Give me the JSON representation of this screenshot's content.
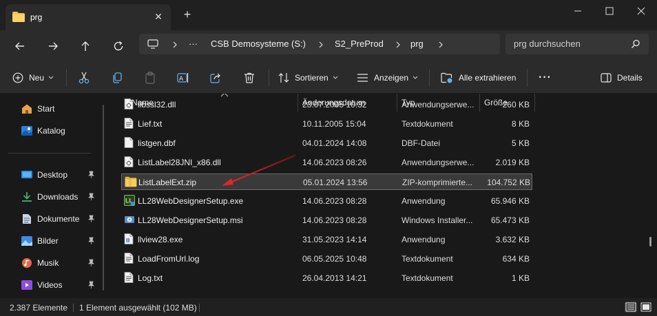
{
  "window": {
    "tab_title": "prg",
    "tab_close": "✕",
    "new_tab": "+"
  },
  "address": {
    "ellipsis": "···",
    "crumbs": [
      "CSB Demosysteme (S:)",
      "S2_PreProd",
      "prg"
    ],
    "search_placeholder": "prg durchsuchen"
  },
  "toolbar": {
    "new_label": "Neu",
    "sort_label": "Sortieren",
    "view_label": "Anzeigen",
    "extract_label": "Alle extrahieren",
    "more_label": "···",
    "details_label": "Details"
  },
  "sidebar": {
    "items": [
      {
        "label": "Start",
        "icon": "home-icon",
        "pinned": false
      },
      {
        "label": "Katalog",
        "icon": "gallery-icon",
        "pinned": false
      },
      {
        "label": "Desktop",
        "icon": "desktop-icon",
        "pinned": true
      },
      {
        "label": "Downloads",
        "icon": "downloads-icon",
        "pinned": true
      },
      {
        "label": "Dokumente",
        "icon": "documents-icon",
        "pinned": true
      },
      {
        "label": "Bilder",
        "icon": "pictures-icon",
        "pinned": true
      },
      {
        "label": "Musik",
        "icon": "music-icon",
        "pinned": true
      },
      {
        "label": "Videos",
        "icon": "videos-icon",
        "pinned": true
      }
    ]
  },
  "columns": {
    "name": "Name",
    "date": "Änderungsdatum",
    "type": "Typ",
    "size": "Größe"
  },
  "files": [
    {
      "name": "libssl32.dll",
      "date": "23.07.2005 10:32",
      "type": "Anwendungserwe...",
      "size": "260 KB",
      "icon": "dll-icon",
      "selected": false
    },
    {
      "name": "Lief.txt",
      "date": "10.11.2005 15:04",
      "type": "Textdokument",
      "size": "8 KB",
      "icon": "text-file-icon",
      "selected": false
    },
    {
      "name": "listgen.dbf",
      "date": "04.01.2024 14:08",
      "type": "DBF-Datei",
      "size": "5 KB",
      "icon": "generic-file-icon",
      "selected": false
    },
    {
      "name": "ListLabel28JNI_x86.dll",
      "date": "14.06.2023 08:26",
      "type": "Anwendungserwe...",
      "size": "2.019 KB",
      "icon": "dll-icon",
      "selected": false
    },
    {
      "name": "ListLabelExt.zip",
      "date": "05.01.2024 13:56",
      "type": "ZIP-komprimierte...",
      "size": "104.752 KB",
      "icon": "zip-folder-icon",
      "selected": true
    },
    {
      "name": "LL28WebDesignerSetup.exe",
      "date": "14.06.2023 08:28",
      "type": "Anwendung",
      "size": "65.946 KB",
      "icon": "setup-exe-icon",
      "selected": false
    },
    {
      "name": "LL28WebDesignerSetup.msi",
      "date": "14.06.2023 08:28",
      "type": "Windows Installer...",
      "size": "65.473 KB",
      "icon": "msi-icon",
      "selected": false
    },
    {
      "name": "llview28.exe",
      "date": "31.05.2023 14:14",
      "type": "Anwendung",
      "size": "3.632 KB",
      "icon": "exe-icon",
      "selected": false
    },
    {
      "name": "LoadFromUrl.log",
      "date": "06.05.2025 10:48",
      "type": "Textdokument",
      "size": "634 KB",
      "icon": "text-file-icon",
      "selected": false
    },
    {
      "name": "Log.txt",
      "date": "26.04.2013 14:21",
      "type": "Textdokument",
      "size": "1 KB",
      "icon": "text-file-icon",
      "selected": false
    }
  ],
  "status": {
    "count": "2.387 Elemente",
    "selection": "1 Element ausgewählt (102 MB)"
  },
  "colors": {
    "accent_arrow": "#d8262c",
    "folder_yellow": "#f4c542"
  }
}
